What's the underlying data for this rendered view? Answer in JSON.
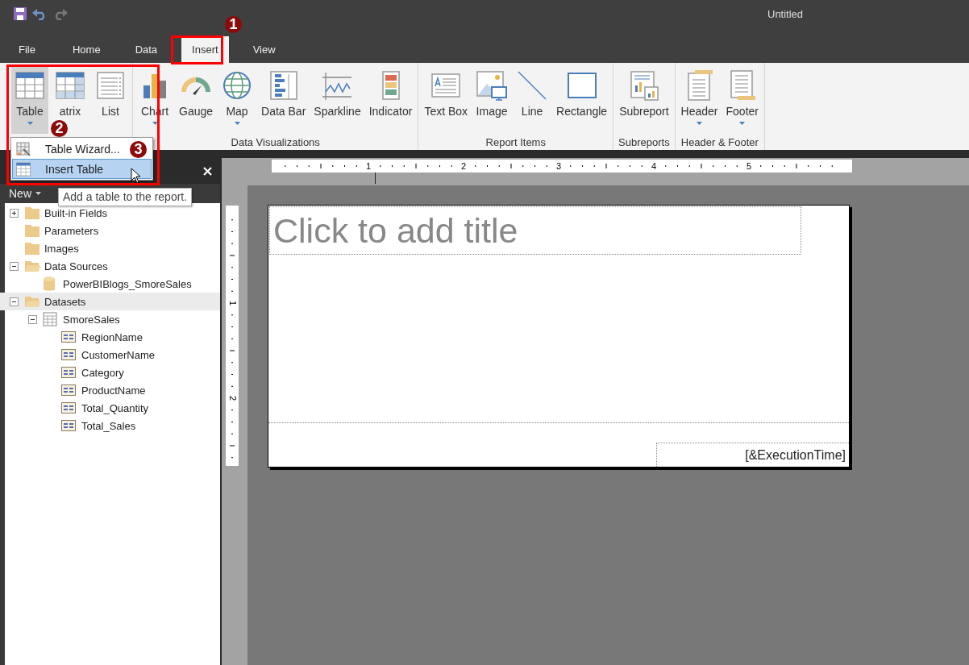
{
  "title_bar": {
    "title": "Untitled"
  },
  "tabs": [
    {
      "label": "File",
      "selected": false
    },
    {
      "label": "Home",
      "selected": false
    },
    {
      "label": "Data",
      "selected": false
    },
    {
      "label": "Insert",
      "selected": true
    },
    {
      "label": "View",
      "selected": false
    }
  ],
  "ribbon": {
    "groups": [
      {
        "buttons": [
          {
            "label": "Table",
            "kind": "table",
            "dropdown": true,
            "selected": true
          },
          {
            "label": "atrix",
            "kind": "matrix",
            "dropdown": false,
            "selected": false
          },
          {
            "label": "List",
            "kind": "list",
            "dropdown": false,
            "selected": false
          }
        ]
      },
      {
        "label": "Data Visualizations",
        "buttons": [
          {
            "label": "Chart",
            "kind": "chart",
            "dropdown": true,
            "selected": false
          },
          {
            "label": "Gauge",
            "kind": "gauge",
            "dropdown": false,
            "selected": false
          },
          {
            "label": "Map",
            "kind": "map",
            "dropdown": true,
            "selected": false
          },
          {
            "label": "Data Bar",
            "kind": "databar",
            "dropdown": false,
            "selected": false
          },
          {
            "label": "Sparkline",
            "kind": "sparkline",
            "dropdown": false,
            "selected": false
          },
          {
            "label": "Indicator",
            "kind": "indicator",
            "dropdown": false,
            "selected": false
          }
        ]
      },
      {
        "label": "Report Items",
        "buttons": [
          {
            "label": "Text Box",
            "kind": "textbox",
            "dropdown": false,
            "selected": false
          },
          {
            "label": "Image",
            "kind": "image",
            "dropdown": false,
            "selected": false
          },
          {
            "label": "Line",
            "kind": "line",
            "dropdown": false,
            "selected": false
          },
          {
            "label": "Rectangle",
            "kind": "rectangle",
            "dropdown": false,
            "selected": false
          }
        ]
      },
      {
        "label": "Subreports",
        "buttons": [
          {
            "label": "Subreport",
            "kind": "subreport",
            "dropdown": false,
            "selected": false
          }
        ]
      },
      {
        "label": "Header & Footer",
        "buttons": [
          {
            "label": "Header",
            "kind": "header",
            "dropdown": true,
            "selected": false
          },
          {
            "label": "Footer",
            "kind": "footer",
            "dropdown": true,
            "selected": false
          }
        ]
      }
    ]
  },
  "dropdown_menu": {
    "items": [
      {
        "label": "Table Wizard...",
        "kind": "wizard",
        "selected": false
      },
      {
        "label": "Insert Table",
        "kind": "table",
        "selected": true
      }
    ]
  },
  "tooltip": {
    "text": "Add a table to the report."
  },
  "report_data_panel": {
    "new_button": "New",
    "tree": [
      {
        "label": "Built-in Fields",
        "kind": "folder",
        "expanded": false,
        "selected": false
      },
      {
        "label": "Parameters",
        "kind": "folder",
        "selected": false
      },
      {
        "label": "Images",
        "kind": "folder",
        "selected": false
      },
      {
        "label": "Data Sources",
        "kind": "folder",
        "expanded": true,
        "selected": false,
        "children": [
          {
            "label": "PowerBIBlogs_SmoreSales",
            "kind": "datasource",
            "selected": false
          }
        ]
      },
      {
        "label": "Datasets",
        "kind": "folder",
        "expanded": true,
        "selected": true,
        "children": [
          {
            "label": "SmoreSales",
            "kind": "dataset",
            "expanded": true,
            "selected": false,
            "children": [
              {
                "label": "RegionName",
                "kind": "field",
                "selected": false
              },
              {
                "label": "CustomerName",
                "kind": "field",
                "selected": false
              },
              {
                "label": "Category",
                "kind": "field",
                "selected": false
              },
              {
                "label": "ProductName",
                "kind": "field",
                "selected": false
              },
              {
                "label": "Total_Quantity",
                "kind": "field",
                "selected": false
              },
              {
                "label": "Total_Sales",
                "kind": "field",
                "selected": false
              }
            ]
          }
        ]
      }
    ]
  },
  "ruler": {
    "horizontal": [
      "1",
      "2",
      "3",
      "4",
      "5"
    ],
    "vertical": [
      "1",
      "2"
    ]
  },
  "report": {
    "title_placeholder": "Click to add title",
    "footer_text": "[&ExecutionTime]"
  },
  "annotations": [
    {
      "label": "1"
    },
    {
      "label": "2"
    },
    {
      "label": "3"
    }
  ]
}
